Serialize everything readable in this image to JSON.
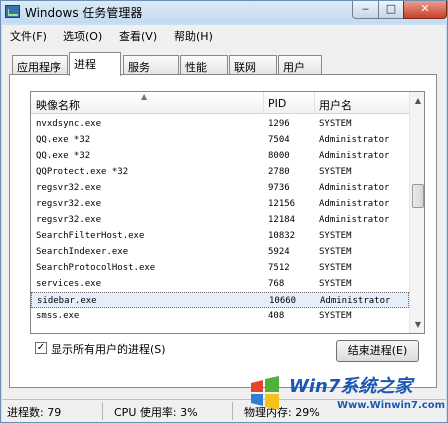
{
  "window": {
    "title": "Windows 任务管理器",
    "minimize": "‒",
    "maximize": "□",
    "close": "✕"
  },
  "menu": [
    "文件(F)",
    "选项(O)",
    "查看(V)",
    "帮助(H)"
  ],
  "tabs": [
    "应用程序",
    "进程",
    "服务",
    "性能",
    "联网",
    "用户"
  ],
  "active_tab": "进程",
  "columns": {
    "name": "映像名称",
    "pid": "PID",
    "user": "用户名"
  },
  "processes": [
    {
      "name": "nvxdsync.exe",
      "pid": "1296",
      "user": "SYSTEM"
    },
    {
      "name": "QQ.exe *32",
      "pid": "7504",
      "user": "Administrator"
    },
    {
      "name": "QQ.exe *32",
      "pid": "8000",
      "user": "Administrator"
    },
    {
      "name": "QQProtect.exe *32",
      "pid": "2780",
      "user": "SYSTEM"
    },
    {
      "name": "regsvr32.exe",
      "pid": "9736",
      "user": "Administrator"
    },
    {
      "name": "regsvr32.exe",
      "pid": "12156",
      "user": "Administrator"
    },
    {
      "name": "regsvr32.exe",
      "pid": "12184",
      "user": "Administrator"
    },
    {
      "name": "SearchFilterHost.exe",
      "pid": "10832",
      "user": "SYSTEM"
    },
    {
      "name": "SearchIndexer.exe",
      "pid": "5924",
      "user": "SYSTEM"
    },
    {
      "name": "SearchProtocolHost.exe",
      "pid": "7512",
      "user": "SYSTEM"
    },
    {
      "name": "services.exe",
      "pid": "768",
      "user": "SYSTEM"
    },
    {
      "name": "sidebar.exe",
      "pid": "10660",
      "user": "Administrator",
      "selected": true
    },
    {
      "name": "smss.exe",
      "pid": "408",
      "user": "SYSTEM"
    }
  ],
  "show_all_users": {
    "label": "显示所有用户的进程(S)",
    "checked": true,
    "mark": "✓"
  },
  "end_process_button": "结束进程(E)",
  "status": {
    "process_count": "进程数: 79",
    "cpu_usage": "CPU 使用率: 3%",
    "memory": "物理内存: 29%"
  },
  "watermark": {
    "brand": "Win7系统之家",
    "url": "Www.Winwin7.com"
  },
  "icons": [
    "app-icon",
    "sort-caret-icon",
    "scroll-up-icon",
    "scroll-down-icon",
    "check-icon"
  ]
}
